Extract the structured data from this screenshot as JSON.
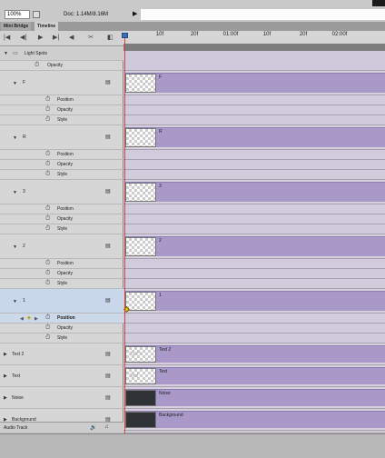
{
  "status": {
    "zoom": "100%",
    "doc_info": "Doc: 1.14M/8.16M",
    "arrow": "▶"
  },
  "tabs": [
    {
      "label": "Mini Bridge"
    },
    {
      "label": "Timeline"
    }
  ],
  "controls": {
    "first": "|◀",
    "prev": "◀|",
    "play": "▶",
    "next": "▶|",
    "audio": "◀",
    "split": "✂",
    "transition": "◧"
  },
  "ruler": {
    "ticks": [
      "10f",
      "20f",
      "01:00f",
      "10f",
      "20f",
      "02:00f"
    ]
  },
  "layers": {
    "group_name": "Light Spots",
    "group_opacity": "Opacity",
    "rows": [
      {
        "name": "F",
        "props": [
          "Position",
          "Opacity",
          "Style"
        ],
        "clip": "F"
      },
      {
        "name": "R",
        "props": [
          "Position",
          "Opacity",
          "Style"
        ],
        "clip": "R"
      },
      {
        "name": "3",
        "props": [
          "Position",
          "Opacity",
          "Style"
        ],
        "clip": "3"
      },
      {
        "name": "2",
        "props": [
          "Position",
          "Opacity",
          "Style"
        ],
        "clip": "2"
      },
      {
        "name": "1",
        "props": [
          "Position",
          "Opacity",
          "Style"
        ],
        "clip": "1"
      }
    ],
    "bottom": [
      {
        "name": "Text 2",
        "clip": "Text 2",
        "thumb_text": "TEXT"
      },
      {
        "name": "Text",
        "clip": "Text",
        "thumb_text": "Text"
      },
      {
        "name": "Noise",
        "clip": "Noise"
      },
      {
        "name": "Background",
        "clip": "Background"
      }
    ],
    "audio": "Audio Track"
  },
  "colors": {
    "clip": "#a999c9",
    "playhead": "#d7413b",
    "selected": "#c8d7ea",
    "keyframe": "#f0c419"
  },
  "icons": {
    "filmstrip": "▤",
    "stopwatch": "⏱",
    "diamond": "◆",
    "triangle_down": "▼",
    "triangle_right": "▶",
    "speaker": "🔊",
    "music": "♫",
    "folder": "▭"
  }
}
